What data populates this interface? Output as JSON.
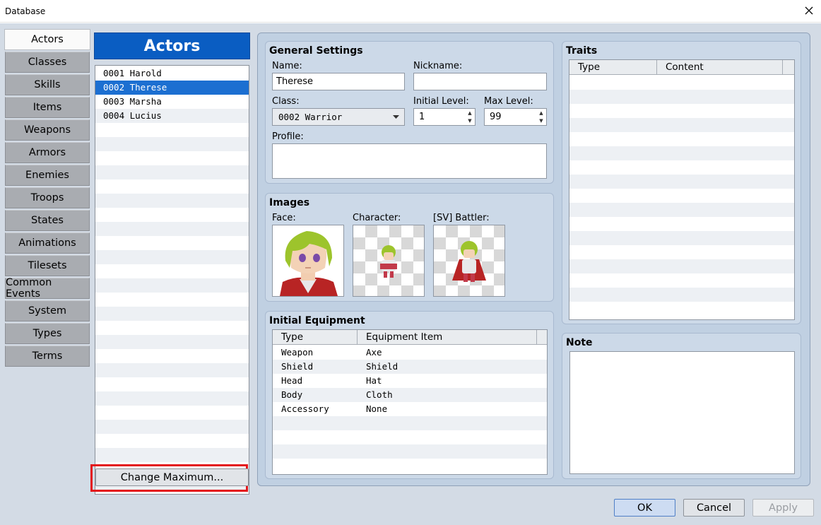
{
  "window": {
    "title": "Database"
  },
  "tabs": [
    {
      "label": "Actors",
      "active": true
    },
    {
      "label": "Classes"
    },
    {
      "label": "Skills"
    },
    {
      "label": "Items"
    },
    {
      "label": "Weapons"
    },
    {
      "label": "Armors"
    },
    {
      "label": "Enemies"
    },
    {
      "label": "Troops"
    },
    {
      "label": "States"
    },
    {
      "label": "Animations"
    },
    {
      "label": "Tilesets"
    },
    {
      "label": "Common Events"
    },
    {
      "label": "System"
    },
    {
      "label": "Types"
    },
    {
      "label": "Terms"
    }
  ],
  "actors_list": {
    "header": "Actors",
    "items": [
      "0001 Harold",
      "0002 Therese",
      "0003 Marsha",
      "0004 Lucius"
    ],
    "selected_index": 1,
    "change_max_label": "Change Maximum..."
  },
  "general": {
    "title": "General Settings",
    "name_label": "Name:",
    "name_value": "Therese",
    "nickname_label": "Nickname:",
    "nickname_value": "",
    "class_label": "Class:",
    "class_value": "0002 Warrior",
    "initial_level_label": "Initial Level:",
    "initial_level_value": "1",
    "max_level_label": "Max Level:",
    "max_level_value": "99",
    "profile_label": "Profile:",
    "profile_value": ""
  },
  "images": {
    "title": "Images",
    "face_label": "Face:",
    "character_label": "Character:",
    "battler_label": "[SV] Battler:"
  },
  "equipment": {
    "title": "Initial Equipment",
    "col_type": "Type",
    "col_item": "Equipment Item",
    "rows": [
      {
        "type": "Weapon",
        "item": "Axe"
      },
      {
        "type": "Shield",
        "item": "Shield"
      },
      {
        "type": "Head",
        "item": "Hat"
      },
      {
        "type": "Body",
        "item": "Cloth"
      },
      {
        "type": "Accessory",
        "item": "None"
      }
    ]
  },
  "traits": {
    "title": "Traits",
    "col_type": "Type",
    "col_content": "Content"
  },
  "note": {
    "title": "Note",
    "value": ""
  },
  "buttons": {
    "ok": "OK",
    "cancel": "Cancel",
    "apply": "Apply"
  },
  "colors": {
    "list_header": "#0a5dc2",
    "selection": "#1c6fd1",
    "highlight_box": "#e3161b",
    "panel_bg": "#c0d0e2"
  }
}
